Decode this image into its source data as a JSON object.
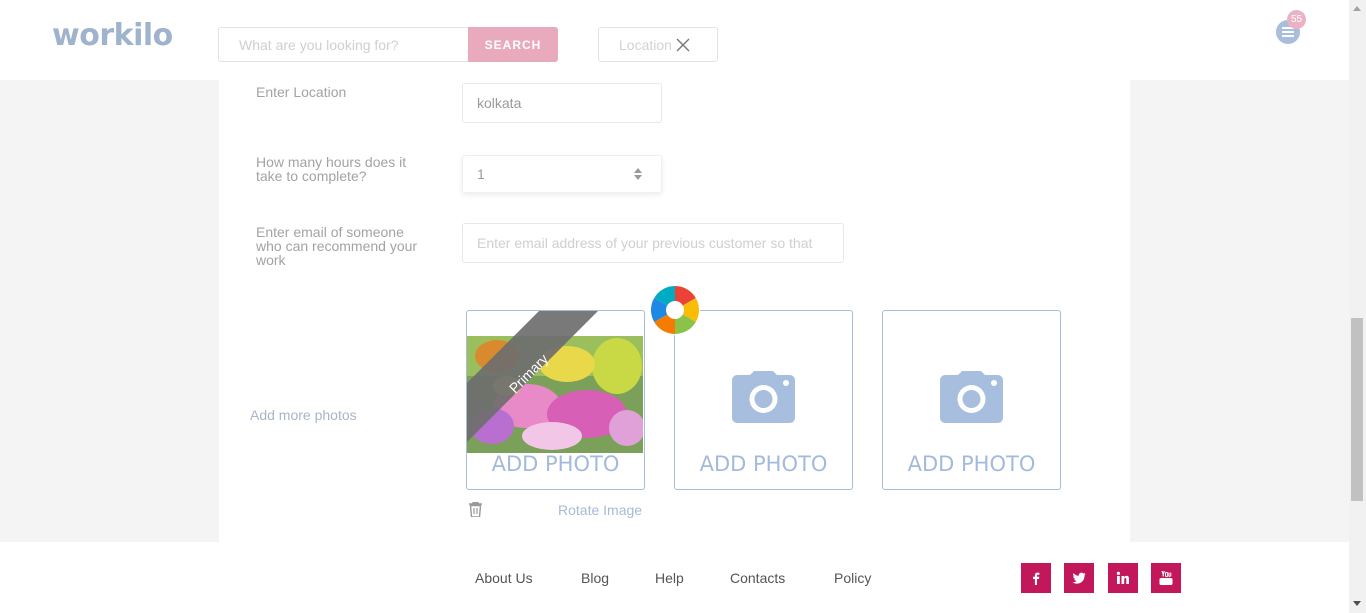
{
  "header": {
    "logo_text": "workilo",
    "search_placeholder": "What are you looking for?",
    "search_button": "SEARCH",
    "location_placeholder": "Location",
    "notification_count": "55"
  },
  "form": {
    "location_label": "Enter Location",
    "location_value": "kolkata",
    "hours_label_line1": "How many hours does it",
    "hours_label_line2": "take to complete?",
    "hours_value": "1",
    "email_label_line1": "Enter email of someone",
    "email_label_line2": "who can recommend your",
    "email_label_line3": "work",
    "email_placeholder": "Enter email address of your previous customer so that",
    "photos_label": "Add more photos"
  },
  "photos": {
    "primary_ribbon": "Primary",
    "add_photo_label": "ADD PHOTO",
    "rotate_label": "Rotate Image"
  },
  "footer": {
    "links": [
      "About Us",
      "Blog",
      "Help",
      "Contacts",
      "Policy"
    ],
    "social": [
      "facebook-icon",
      "twitter-icon",
      "linkedin-icon",
      "youtube-icon"
    ]
  },
  "colors": {
    "accent": "#c2185b",
    "search_button": "#e9aabd",
    "photo_border": "#a9bddb",
    "badge": "#eab3c4"
  }
}
